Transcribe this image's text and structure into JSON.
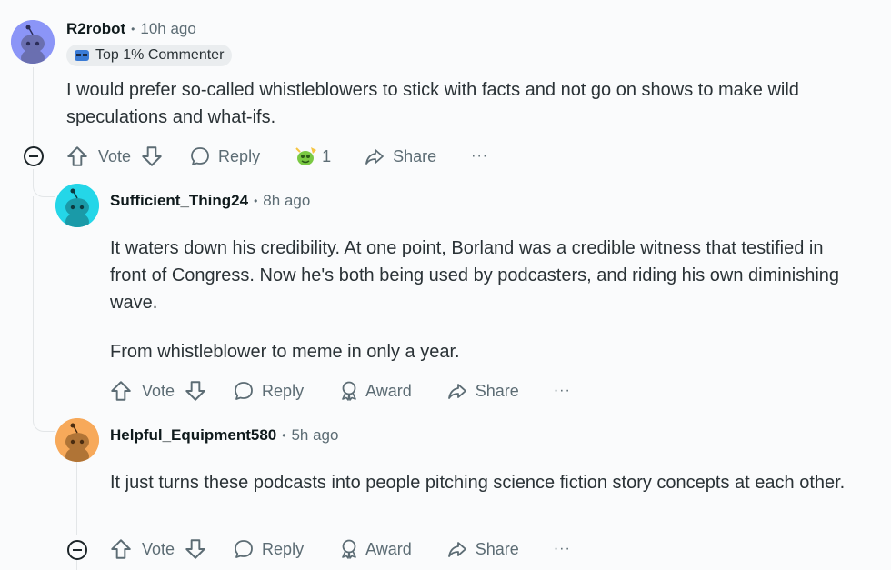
{
  "comments": [
    {
      "username": "R2robot",
      "time": "10h ago",
      "flair": "Top 1% Commenter",
      "body": [
        "I would prefer so-called whistleblowers to stick with facts and not go on shows to make wild speculations and what-ifs."
      ],
      "actions": {
        "vote": "Vote",
        "reply": "Reply",
        "award_count": "1",
        "share": "Share",
        "more": "···"
      },
      "avatar_color": "#8b95f7"
    },
    {
      "username": "Sufficient_Thing24",
      "time": "8h ago",
      "body": [
        "It waters down his credibility. At one point, Borland was a credible witness that testified in front of Congress. Now he's both being used by podcasters, and riding his own diminishing wave.",
        "From whistleblower to meme in only a year."
      ],
      "actions": {
        "vote": "Vote",
        "reply": "Reply",
        "award": "Award",
        "share": "Share",
        "more": "···"
      },
      "avatar_color": "#24d6e8"
    },
    {
      "username": "Helpful_Equipment580",
      "time": "5h ago",
      "body": [
        "It just turns these podcasts into people pitching science fiction story concepts at each other."
      ],
      "actions": {
        "vote": "Vote",
        "reply": "Reply",
        "award": "Award",
        "share": "Share",
        "more": "···"
      },
      "avatar_color": "#f7a95a"
    }
  ],
  "separator": "•"
}
